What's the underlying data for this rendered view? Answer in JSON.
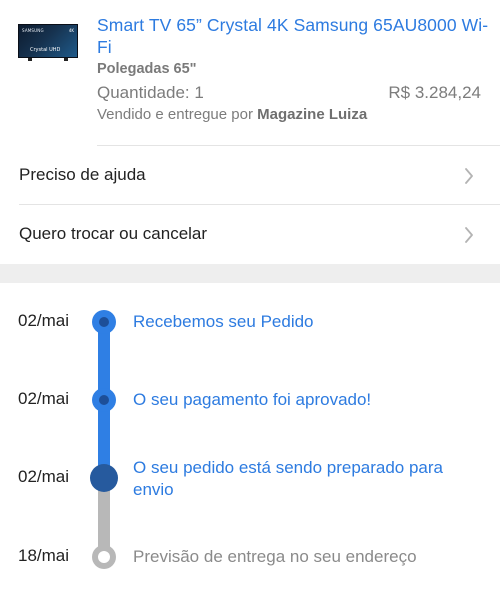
{
  "product": {
    "title": "Smart TV 65” Crystal 4K Samsung 65AU8000 Wi-Fi",
    "thumbnail": {
      "brand": "SAMSUNG",
      "badge": "4K",
      "tagline": "Crystal UHD"
    },
    "size": "Polegadas 65\"",
    "quantity": "Quantidade: 1",
    "price": "R$ 3.284,24",
    "seller_prefix": "Vendido e entregue por",
    "seller_name": "Magazine Luiza"
  },
  "menu": {
    "help": "Preciso de ajuda",
    "exchange": "Quero trocar ou cancelar"
  },
  "timeline": [
    {
      "date": "02/mai",
      "text": "Recebemos seu Pedido",
      "status": "done"
    },
    {
      "date": "02/mai",
      "text": "O seu pagamento foi aprovado!",
      "status": "done"
    },
    {
      "date": "02/mai",
      "text": "O seu pedido está sendo preparado para envio",
      "status": "current"
    },
    {
      "date": "18/mai",
      "text": "Previsão de entrega no seu endereço",
      "status": "pending"
    }
  ],
  "colors": {
    "accent": "#2f7fe4",
    "accent_dark": "#265a9e",
    "pending": "#b8b8b8",
    "link_text": "#2d7be0"
  }
}
